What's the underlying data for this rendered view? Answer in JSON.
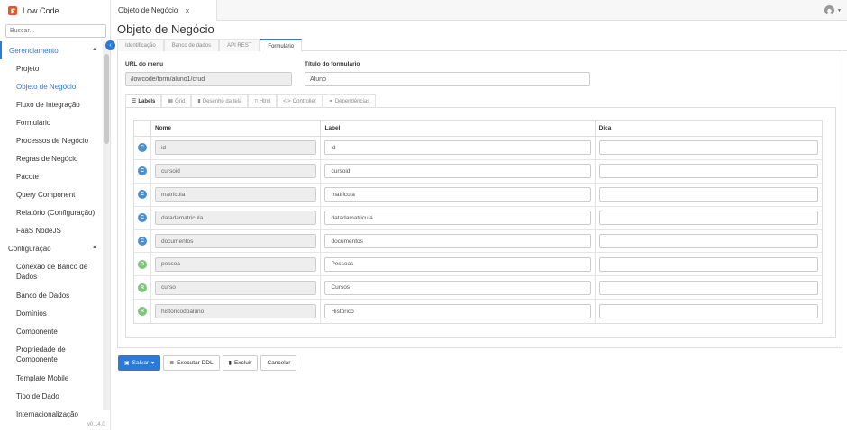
{
  "app": {
    "title": "Low Code",
    "version": "v0.14.0"
  },
  "sidebar": {
    "search_placeholder": "Buscar...",
    "groups": [
      {
        "label": "Gerenciamento",
        "items": [
          "Projeto",
          "Objeto de Negócio",
          "Fluxo de Integração",
          "Formulário",
          "Processos de Negócio",
          "Regras de Negócio",
          "Pacote",
          "Query Component",
          "Relatório (Configuração)",
          "FaaS NodeJS"
        ]
      },
      {
        "label": "Configuração",
        "items": [
          "Conexão de Banco de Dados",
          "Banco de Dados",
          "Domínios",
          "Componente",
          "Propriedade de Componente",
          "Template Mobile",
          "Tipo de Dado",
          "Internacionalização"
        ]
      }
    ]
  },
  "topbar": {
    "tab_label": "Objeto de Negócio",
    "close": "×"
  },
  "page": {
    "title": "Objeto de Negócio"
  },
  "tabs": [
    "Identificação",
    "Banco de dados",
    "API REST",
    "Formulário"
  ],
  "form": {
    "url_label": "URL do menu",
    "url_value": "/lowcode/form/aluno1/crud",
    "titulo_label": "Título do formulário",
    "titulo_value": "Aluno"
  },
  "subtabs": [
    {
      "icon": "list-icon",
      "glyph": "☰",
      "label": "Labels"
    },
    {
      "icon": "grid-icon",
      "glyph": "▦",
      "label": "Grid"
    },
    {
      "icon": "file-icon",
      "glyph": "▮",
      "label": "Desenho da tela"
    },
    {
      "icon": "html-icon",
      "glyph": "▯",
      "label": "Html"
    },
    {
      "icon": "code-icon",
      "glyph": "</>",
      "label": "Controller"
    },
    {
      "icon": "link-icon",
      "glyph": "⚭",
      "label": "Dependências"
    }
  ],
  "table": {
    "headers": [
      "Nome",
      "Label",
      "Dica"
    ],
    "rows": [
      {
        "type": "C",
        "nome": "id",
        "label": "id",
        "dica": ""
      },
      {
        "type": "C",
        "nome": "cursoid",
        "label": "cursoid",
        "dica": ""
      },
      {
        "type": "C",
        "nome": "matricula",
        "label": "matricula",
        "dica": ""
      },
      {
        "type": "C",
        "nome": "datadamatricula",
        "label": "datadamatricula",
        "dica": ""
      },
      {
        "type": "C",
        "nome": "documentos",
        "label": "documentos",
        "dica": ""
      },
      {
        "type": "R",
        "nome": "pessoa",
        "label": "Pessoas",
        "dica": ""
      },
      {
        "type": "R",
        "nome": "curso",
        "label": "Cursos",
        "dica": ""
      },
      {
        "type": "R",
        "nome": "historicodoaluno",
        "label": "Histórico",
        "dica": ""
      }
    ]
  },
  "actions": {
    "save": "Salvar",
    "ddl": "Executar DDL",
    "delete": "Excluir",
    "cancel": "Cancelar"
  },
  "colors": {
    "accent": "#2b7ad8",
    "brand": "#e8542f",
    "badge_c": "#4a8fd4",
    "badge_r": "#7cc67c"
  }
}
